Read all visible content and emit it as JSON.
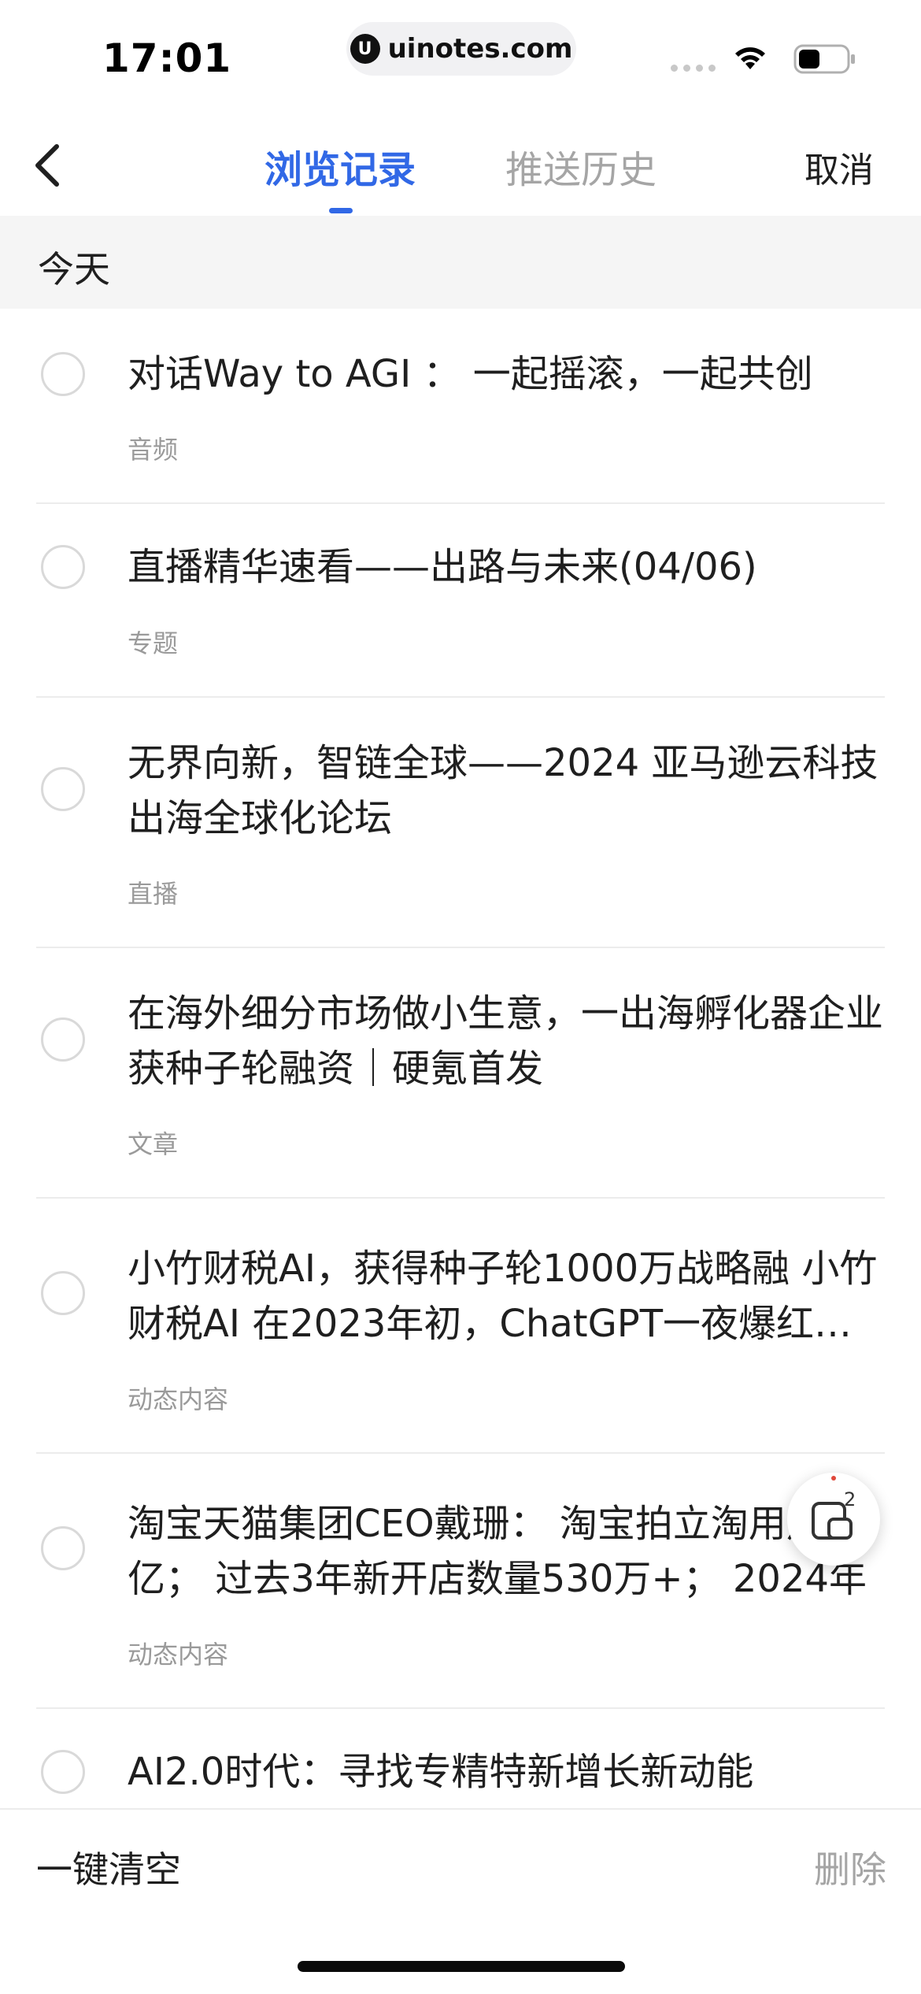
{
  "status_bar": {
    "time": "17:01",
    "url": "uinotes.com"
  },
  "header": {
    "tabs": [
      {
        "label": "浏览记录",
        "active": true
      },
      {
        "label": "推送历史",
        "active": false
      }
    ],
    "cancel_label": "取消"
  },
  "section": {
    "label": "今天"
  },
  "items": [
    {
      "title": "对话Way to AGI ： 一起摇滚，一起共创",
      "tag": "音频"
    },
    {
      "title": "直播精华速看——出路与未来(04/06)",
      "tag": "专题"
    },
    {
      "title": "无界向新，智链全球——2024 亚马逊云科技出海全球化论坛",
      "tag": "直播"
    },
    {
      "title": "在海外细分市场做小生意，一出海孵化器企业获种子轮融资｜硬氪首发",
      "tag": "文章"
    },
    {
      "title": "小竹财税AI，获得种子轮1000万战略融 小竹财税AI 在2023年初，ChatGPT一夜爆红，AI技术",
      "tag": "动态内容"
    },
    {
      "title": "淘宝天猫集团CEO戴珊： 淘宝拍立淘用户过亿； 过去3年新开店数量530万+； 2024年",
      "tag": "动态内容"
    },
    {
      "title": "AI2.0时代：寻找专精特新增长新动能",
      "tag": ""
    }
  ],
  "float_button": {
    "badge": "2"
  },
  "bottom_bar": {
    "clear_label": "一键清空",
    "delete_label": "删除"
  },
  "colors": {
    "accent": "#3168e6",
    "inactive": "#a5a5a5",
    "section_bg": "#f5f5f5"
  }
}
